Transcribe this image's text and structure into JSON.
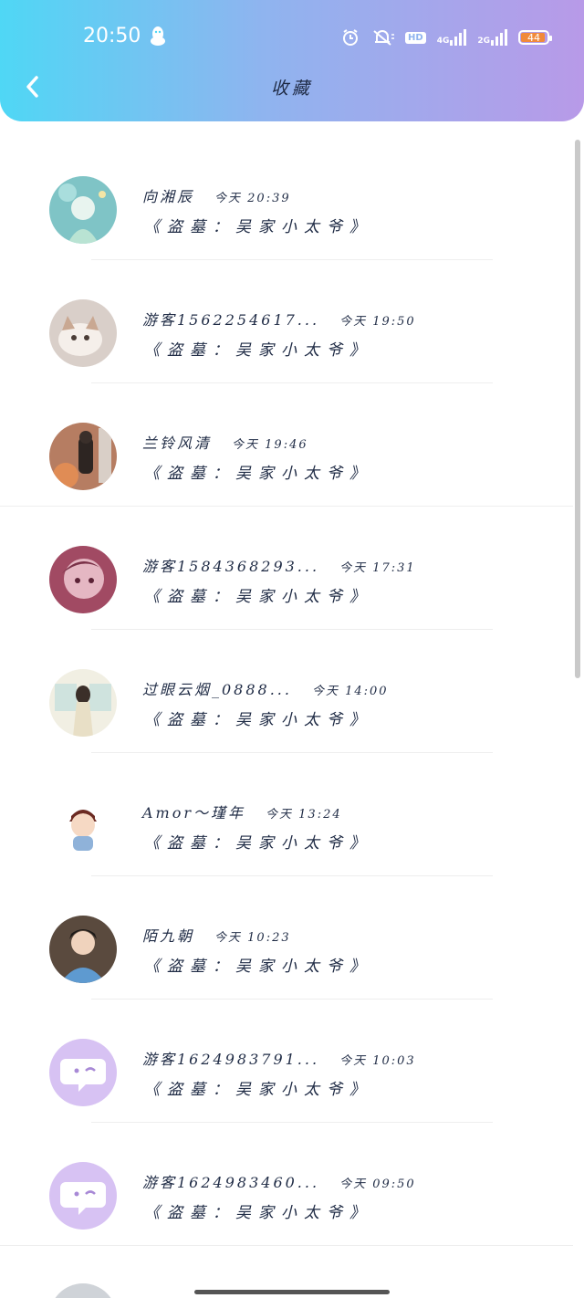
{
  "status_bar": {
    "time": "20:50",
    "network_1": "4G",
    "network_2": "2G",
    "hd_label": "HD",
    "battery": "44"
  },
  "header": {
    "title": "收藏"
  },
  "favorites": [
    {
      "user": "向湘辰",
      "time": "今天 20:39",
      "item": "《盗墓：吴家小太爷》",
      "avatar": "anime-fairy"
    },
    {
      "user": "游客1562254617...",
      "time": "今天 19:50",
      "item": "《盗墓：吴家小太爷》",
      "avatar": "kitten"
    },
    {
      "user": "兰铃风清",
      "time": "今天 19:46",
      "item": "《盗墓：吴家小太爷》",
      "avatar": "autumn-figure"
    },
    {
      "user": "游客1584368293...",
      "time": "今天 17:31",
      "item": "《盗墓：吴家小太爷》",
      "avatar": "anime-boy"
    },
    {
      "user": "过眼云烟_0888...",
      "time": "今天 14:00",
      "item": "《盗墓：吴家小太爷》",
      "avatar": "girl-window"
    },
    {
      "user": "Amor～瑾年",
      "time": "今天 13:24",
      "item": "《盗墓：吴家小太爷》",
      "avatar": "chibi"
    },
    {
      "user": "陌九朝",
      "time": "今天 10:23",
      "item": "《盗墓：吴家小太爷》",
      "avatar": "young-man"
    },
    {
      "user": "游客1624983791...",
      "time": "今天 10:03",
      "item": "《盗墓：吴家小太爷》",
      "avatar": "default-chat"
    },
    {
      "user": "游客1624983460...",
      "time": "今天 09:50",
      "item": "《盗墓：吴家小太爷》",
      "avatar": "default-chat"
    }
  ],
  "colors": {
    "header_start": "#4fd7f5",
    "header_end": "#b89ae8",
    "text": "#1f2b45",
    "default_avatar": "#d7c2f3"
  },
  "icons": {
    "back": "chevron-left-icon",
    "qq": "qq-penguin-icon"
  }
}
